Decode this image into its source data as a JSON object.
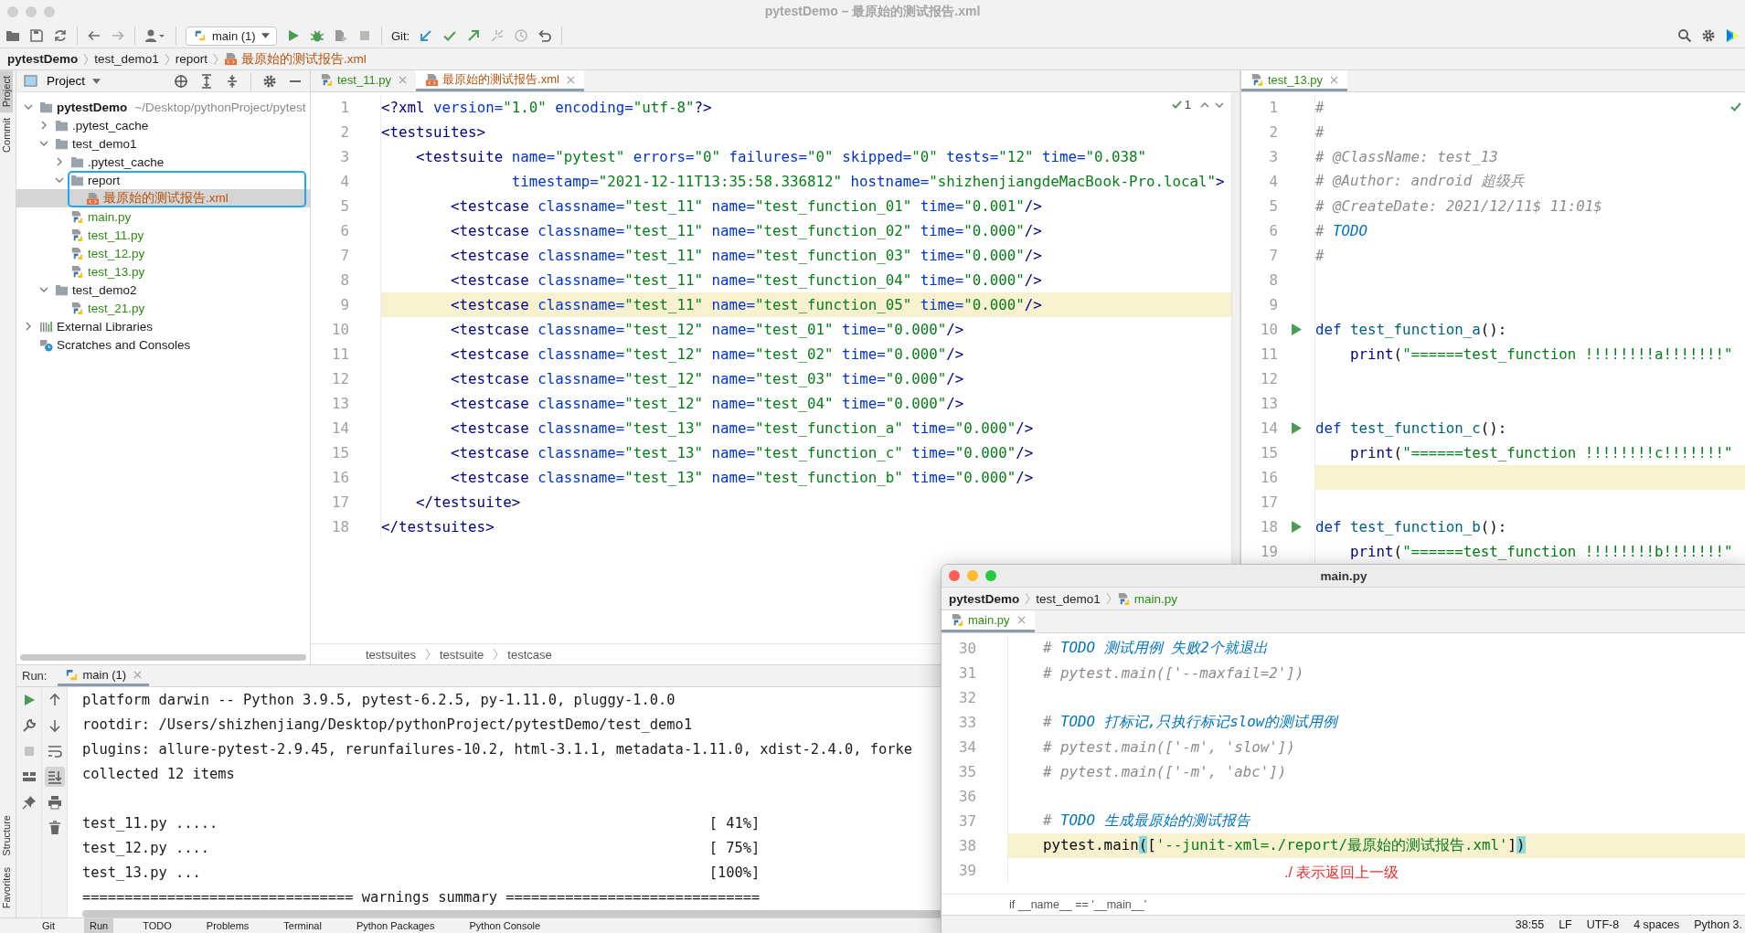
{
  "window": {
    "title": "pytestDemo – 最原始的测试报告.xml"
  },
  "toolbar": {
    "run_config": "main (1)",
    "git_label": "Git:"
  },
  "breadcrumb": [
    {
      "label": "pytestDemo",
      "kind": "project"
    },
    {
      "label": "test_demo1",
      "kind": "folder"
    },
    {
      "label": "report",
      "kind": "folder"
    },
    {
      "label": "最原始的测试报告.xml",
      "kind": "xml",
      "color": "#b5520b"
    }
  ],
  "side_tabs_top": [
    {
      "label": "Project",
      "selected": true
    },
    {
      "label": "Commit",
      "selected": false
    }
  ],
  "side_tabs_bottom": [
    {
      "label": "Structure",
      "selected": false
    },
    {
      "label": "Favorites",
      "selected": false
    }
  ],
  "project": {
    "title": "Project",
    "tree": [
      {
        "label": "pytestDemo",
        "path": "~/Desktop/pythonProject/pytest",
        "kind": "project",
        "expanded": true,
        "selected": false,
        "children": [
          {
            "label": ".pytest_cache",
            "kind": "folder",
            "expanded": false,
            "selected": false
          },
          {
            "label": "test_demo1",
            "kind": "folder",
            "expanded": true,
            "selected": false,
            "children": [
              {
                "label": ".pytest_cache",
                "kind": "folder",
                "expanded": false,
                "selected": false
              },
              {
                "label": "report",
                "kind": "folder",
                "expanded": true,
                "selected": false,
                "annotated": true,
                "children": [
                  {
                    "label": "最原始的测试报告.xml",
                    "kind": "xml",
                    "color": "#b5520b",
                    "selected": true
                  }
                ]
              },
              {
                "label": "main.py",
                "kind": "python",
                "color": "#2f8a14",
                "selected": false
              },
              {
                "label": "test_11.py",
                "kind": "python",
                "color": "#2f8a14",
                "selected": false
              },
              {
                "label": "test_12.py",
                "kind": "python",
                "color": "#2f8a14",
                "selected": false
              },
              {
                "label": "test_13.py",
                "kind": "python",
                "color": "#2f8a14",
                "selected": false
              }
            ]
          },
          {
            "label": "test_demo2",
            "kind": "folder",
            "expanded": true,
            "selected": false,
            "children": [
              {
                "label": "test_21.py",
                "kind": "python",
                "color": "#2f8a14",
                "selected": false
              }
            ]
          }
        ]
      },
      {
        "label": "External Libraries",
        "kind": "library",
        "expanded": false,
        "selected": false
      },
      {
        "label": "Scratches and Consoles",
        "kind": "scratches",
        "selected": false
      }
    ]
  },
  "editor_left": {
    "tabs": [
      {
        "label": "test_11.py",
        "kind": "python",
        "color": "#2f8a14",
        "selected": false
      },
      {
        "label": "最原始的测试报告.xml",
        "kind": "xml",
        "color": "#b5520b",
        "selected": true
      }
    ],
    "inspections": "1",
    "lines": [
      {
        "number": "1",
        "current": false,
        "tokens": [
          {
            "kind": "tag",
            "text": "<?xml"
          },
          {
            "kind": "attr",
            "text": " version="
          },
          {
            "kind": "value",
            "text": "\"1.0\""
          },
          {
            "kind": "attr",
            "text": " encoding="
          },
          {
            "kind": "value",
            "text": "\"utf-8\""
          },
          {
            "kind": "tag",
            "text": "?>"
          }
        ]
      },
      {
        "number": "2",
        "current": false,
        "tokens": [
          {
            "kind": "tag",
            "text": "<testsuites>"
          }
        ]
      },
      {
        "number": "3",
        "current": false,
        "tokens": [
          {
            "kind": "tag",
            "text": "    <testsuite"
          },
          {
            "kind": "attr",
            "text": " name="
          },
          {
            "kind": "value",
            "text": "\"pytest\""
          },
          {
            "kind": "attr",
            "text": " errors="
          },
          {
            "kind": "value",
            "text": "\"0\""
          },
          {
            "kind": "attr",
            "text": " failures="
          },
          {
            "kind": "value",
            "text": "\"0\""
          },
          {
            "kind": "attr",
            "text": " skipped="
          },
          {
            "kind": "value",
            "text": "\"0\""
          },
          {
            "kind": "attr",
            "text": " tests="
          },
          {
            "kind": "value",
            "text": "\"12\""
          },
          {
            "kind": "attr",
            "text": " time="
          },
          {
            "kind": "value",
            "text": "\"0.038\""
          }
        ]
      },
      {
        "number": "4",
        "current": false,
        "tokens": [
          {
            "kind": "attr",
            "text": "               timestamp="
          },
          {
            "kind": "value",
            "text": "\"2021-12-11T13:35:58.336812\""
          },
          {
            "kind": "attr",
            "text": " hostname="
          },
          {
            "kind": "value",
            "text": "\"shizhenjiangdeMacBook-Pro.local\""
          },
          {
            "kind": "tag",
            "text": ">"
          }
        ]
      },
      {
        "number": "5",
        "current": false,
        "tokens": [
          {
            "kind": "tag",
            "text": "        <testcase"
          },
          {
            "kind": "attr",
            "text": " classname="
          },
          {
            "kind": "value",
            "text": "\"test_11\""
          },
          {
            "kind": "attr",
            "text": " name="
          },
          {
            "kind": "value",
            "text": "\"test_function_01\""
          },
          {
            "kind": "attr",
            "text": " time="
          },
          {
            "kind": "value",
            "text": "\"0.001\""
          },
          {
            "kind": "tag",
            "text": "/>"
          }
        ]
      },
      {
        "number": "6",
        "current": false,
        "tokens": [
          {
            "kind": "tag",
            "text": "        <testcase"
          },
          {
            "kind": "attr",
            "text": " classname="
          },
          {
            "kind": "value",
            "text": "\"test_11\""
          },
          {
            "kind": "attr",
            "text": " name="
          },
          {
            "kind": "value",
            "text": "\"test_function_02\""
          },
          {
            "kind": "attr",
            "text": " time="
          },
          {
            "kind": "value",
            "text": "\"0.000\""
          },
          {
            "kind": "tag",
            "text": "/>"
          }
        ]
      },
      {
        "number": "7",
        "current": false,
        "tokens": [
          {
            "kind": "tag",
            "text": "        <testcase"
          },
          {
            "kind": "attr",
            "text": " classname="
          },
          {
            "kind": "value",
            "text": "\"test_11\""
          },
          {
            "kind": "attr",
            "text": " name="
          },
          {
            "kind": "value",
            "text": "\"test_function_03\""
          },
          {
            "kind": "attr",
            "text": " time="
          },
          {
            "kind": "value",
            "text": "\"0.000\""
          },
          {
            "kind": "tag",
            "text": "/>"
          }
        ]
      },
      {
        "number": "8",
        "current": false,
        "tokens": [
          {
            "kind": "tag",
            "text": "        <testcase"
          },
          {
            "kind": "attr",
            "text": " classname="
          },
          {
            "kind": "value",
            "text": "\"test_11\""
          },
          {
            "kind": "attr",
            "text": " name="
          },
          {
            "kind": "value",
            "text": "\"test_function_04\""
          },
          {
            "kind": "attr",
            "text": " time="
          },
          {
            "kind": "value",
            "text": "\"0.000\""
          },
          {
            "kind": "tag",
            "text": "/>"
          }
        ]
      },
      {
        "number": "9",
        "current": true,
        "tokens": [
          {
            "kind": "tag",
            "text": "        <testcase"
          },
          {
            "kind": "attr",
            "text": " classname="
          },
          {
            "kind": "value",
            "text": "\"test_11\""
          },
          {
            "kind": "attr",
            "text": " name="
          },
          {
            "kind": "value",
            "text": "\"test_function_05\""
          },
          {
            "kind": "attr",
            "text": " time="
          },
          {
            "kind": "value",
            "text": "\"0.000\""
          },
          {
            "kind": "tag",
            "text": "/>"
          }
        ]
      },
      {
        "number": "10",
        "current": false,
        "tokens": [
          {
            "kind": "tag",
            "text": "        <testcase"
          },
          {
            "kind": "attr",
            "text": " classname="
          },
          {
            "kind": "value",
            "text": "\"test_12\""
          },
          {
            "kind": "attr",
            "text": " name="
          },
          {
            "kind": "value",
            "text": "\"test_01\""
          },
          {
            "kind": "attr",
            "text": " time="
          },
          {
            "kind": "value",
            "text": "\"0.000\""
          },
          {
            "kind": "tag",
            "text": "/>"
          }
        ]
      },
      {
        "number": "11",
        "current": false,
        "tokens": [
          {
            "kind": "tag",
            "text": "        <testcase"
          },
          {
            "kind": "attr",
            "text": " classname="
          },
          {
            "kind": "value",
            "text": "\"test_12\""
          },
          {
            "kind": "attr",
            "text": " name="
          },
          {
            "kind": "value",
            "text": "\"test_02\""
          },
          {
            "kind": "attr",
            "text": " time="
          },
          {
            "kind": "value",
            "text": "\"0.000\""
          },
          {
            "kind": "tag",
            "text": "/>"
          }
        ]
      },
      {
        "number": "12",
        "current": false,
        "tokens": [
          {
            "kind": "tag",
            "text": "        <testcase"
          },
          {
            "kind": "attr",
            "text": " classname="
          },
          {
            "kind": "value",
            "text": "\"test_12\""
          },
          {
            "kind": "attr",
            "text": " name="
          },
          {
            "kind": "value",
            "text": "\"test_03\""
          },
          {
            "kind": "attr",
            "text": " time="
          },
          {
            "kind": "value",
            "text": "\"0.000\""
          },
          {
            "kind": "tag",
            "text": "/>"
          }
        ]
      },
      {
        "number": "13",
        "current": false,
        "tokens": [
          {
            "kind": "tag",
            "text": "        <testcase"
          },
          {
            "kind": "attr",
            "text": " classname="
          },
          {
            "kind": "value",
            "text": "\"test_12\""
          },
          {
            "kind": "attr",
            "text": " name="
          },
          {
            "kind": "value",
            "text": "\"test_04\""
          },
          {
            "kind": "attr",
            "text": " time="
          },
          {
            "kind": "value",
            "text": "\"0.000\""
          },
          {
            "kind": "tag",
            "text": "/>"
          }
        ]
      },
      {
        "number": "14",
        "current": false,
        "tokens": [
          {
            "kind": "tag",
            "text": "        <testcase"
          },
          {
            "kind": "attr",
            "text": " classname="
          },
          {
            "kind": "value",
            "text": "\"test_13\""
          },
          {
            "kind": "attr",
            "text": " name="
          },
          {
            "kind": "value",
            "text": "\"test_function_a\""
          },
          {
            "kind": "attr",
            "text": " time="
          },
          {
            "kind": "value",
            "text": "\"0.000\""
          },
          {
            "kind": "tag",
            "text": "/>"
          }
        ]
      },
      {
        "number": "15",
        "current": false,
        "tokens": [
          {
            "kind": "tag",
            "text": "        <testcase"
          },
          {
            "kind": "attr",
            "text": " classname="
          },
          {
            "kind": "value",
            "text": "\"test_13\""
          },
          {
            "kind": "attr",
            "text": " name="
          },
          {
            "kind": "value",
            "text": "\"test_function_c\""
          },
          {
            "kind": "attr",
            "text": " time="
          },
          {
            "kind": "value",
            "text": "\"0.000\""
          },
          {
            "kind": "tag",
            "text": "/>"
          }
        ]
      },
      {
        "number": "16",
        "current": false,
        "tokens": [
          {
            "kind": "tag",
            "text": "        <testcase"
          },
          {
            "kind": "attr",
            "text": " classname="
          },
          {
            "kind": "value",
            "text": "\"test_13\""
          },
          {
            "kind": "attr",
            "text": " name="
          },
          {
            "kind": "value",
            "text": "\"test_function_b\""
          },
          {
            "kind": "attr",
            "text": " time="
          },
          {
            "kind": "value",
            "text": "\"0.000\""
          },
          {
            "kind": "tag",
            "text": "/>"
          }
        ]
      },
      {
        "number": "17",
        "current": false,
        "tokens": [
          {
            "kind": "tag",
            "text": "    </testsuite>"
          }
        ]
      },
      {
        "number": "18",
        "current": false,
        "tokens": [
          {
            "kind": "tag",
            "text": "</testsuites>"
          }
        ]
      }
    ],
    "breadcrumb": [
      "testsuites",
      "testsuite",
      "testcase"
    ]
  },
  "editor_right": {
    "tabs": [
      {
        "label": "test_13.py",
        "kind": "python",
        "color": "#2f8a14",
        "selected": true
      }
    ],
    "lines": [
      {
        "number": "1",
        "current": false,
        "run": false,
        "tokens": [
          {
            "kind": "comment",
            "text": "#"
          }
        ]
      },
      {
        "number": "2",
        "current": false,
        "run": false,
        "tokens": [
          {
            "kind": "comment",
            "text": "#"
          }
        ]
      },
      {
        "number": "3",
        "current": false,
        "run": false,
        "tokens": [
          {
            "kind": "comment",
            "text": "# @ClassName: test_13"
          }
        ]
      },
      {
        "number": "4",
        "current": false,
        "run": false,
        "tokens": [
          {
            "kind": "comment",
            "text": "# @Author: android 超级兵"
          }
        ]
      },
      {
        "number": "5",
        "current": false,
        "run": false,
        "tokens": [
          {
            "kind": "comment",
            "text": "# @CreateDate: 2021/12/11$ 11:01$"
          }
        ]
      },
      {
        "number": "6",
        "current": false,
        "run": false,
        "tokens": [
          {
            "kind": "comment",
            "text": "# "
          },
          {
            "kind": "todo",
            "text": "TODO"
          }
        ]
      },
      {
        "number": "7",
        "current": false,
        "run": false,
        "tokens": [
          {
            "kind": "comment",
            "text": "#"
          }
        ]
      },
      {
        "number": "8",
        "current": false,
        "run": false
      },
      {
        "number": "9",
        "current": false,
        "run": false
      },
      {
        "number": "10",
        "current": false,
        "run": true,
        "tokens": [
          {
            "kind": "keyword",
            "text": "def"
          },
          {
            "kind": "func",
            "text": " test_function_a"
          },
          {
            "kind": "plain",
            "text": "():"
          }
        ]
      },
      {
        "number": "11",
        "current": false,
        "run": false,
        "tokens": [
          {
            "kind": "builtin",
            "text": "    print"
          },
          {
            "kind": "plain",
            "text": "("
          },
          {
            "kind": "string",
            "text": "\"======test_function !!!!!!!!a!!!!!!!\""
          }
        ]
      },
      {
        "number": "12",
        "current": false,
        "run": false
      },
      {
        "number": "13",
        "current": false,
        "run": false
      },
      {
        "number": "14",
        "current": false,
        "run": true,
        "tokens": [
          {
            "kind": "keyword",
            "text": "def"
          },
          {
            "kind": "func",
            "text": " test_function_c"
          },
          {
            "kind": "plain",
            "text": "():"
          }
        ]
      },
      {
        "number": "15",
        "current": false,
        "run": false,
        "tokens": [
          {
            "kind": "builtin",
            "text": "    print"
          },
          {
            "kind": "plain",
            "text": "("
          },
          {
            "kind": "string",
            "text": "\"======test_function !!!!!!!!c!!!!!!!\""
          }
        ]
      },
      {
        "number": "16",
        "current": true,
        "run": false
      },
      {
        "number": "17",
        "current": false,
        "run": false
      },
      {
        "number": "18",
        "current": false,
        "run": true,
        "tokens": [
          {
            "kind": "keyword",
            "text": "def"
          },
          {
            "kind": "func",
            "text": " test_function_b"
          },
          {
            "kind": "plain",
            "text": "():"
          }
        ]
      },
      {
        "number": "19",
        "current": false,
        "run": false,
        "tokens": [
          {
            "kind": "builtin",
            "text": "    print"
          },
          {
            "kind": "plain",
            "text": "("
          },
          {
            "kind": "string",
            "text": "\"======test_function !!!!!!!!b!!!!!!!\""
          }
        ]
      }
    ]
  },
  "run_panel": {
    "label": "Run:",
    "tab": "main (1)",
    "output": [
      {
        "kind": "text",
        "text": "platform darwin -- Python 3.9.5, pytest-6.2.5, py-1.11.0, pluggy-1.0.0"
      },
      {
        "kind": "text",
        "text": "rootdir: /Users/shizhenjiang/Desktop/pythonProject/pytestDemo/test_demo1"
      },
      {
        "kind": "text",
        "text": "plugins: allure-pytest-2.9.45, rerunfailures-10.2, html-3.1.1, metadata-1.11.0, xdist-2.4.0, forke"
      },
      {
        "kind": "text",
        "text": "collected 12 items"
      },
      {
        "kind": "blank"
      },
      {
        "kind": "progress",
        "text": "test_11.py .....",
        "progress": "[ 41%]"
      },
      {
        "kind": "progress",
        "text": "test_12.py ....",
        "progress": "[ 75%]"
      },
      {
        "kind": "progress",
        "text": "test_13.py ...",
        "progress": "[100%]"
      },
      {
        "kind": "text",
        "text": "================================ warnings summary =============================="
      }
    ]
  },
  "tool_tabs": [
    {
      "label": "Git",
      "selected": false
    },
    {
      "label": "Run",
      "selected": true
    },
    {
      "label": "TODO",
      "selected": false
    },
    {
      "label": "Problems",
      "selected": false
    },
    {
      "label": "Terminal",
      "selected": false
    },
    {
      "label": "Python Packages",
      "selected": false
    },
    {
      "label": "Python Console",
      "selected": false
    }
  ],
  "popup": {
    "title": "main.py",
    "breadcrumb": [
      {
        "label": "pytestDemo",
        "kind": "project"
      },
      {
        "label": "test_demo1",
        "kind": "folder"
      },
      {
        "label": "main.py",
        "kind": "python",
        "color": "#2f8a14"
      }
    ],
    "tabs": [
      {
        "label": "main.py",
        "kind": "python",
        "color": "#2f8a14",
        "selected": true
      }
    ],
    "lines": [
      {
        "number": "30",
        "current": false,
        "tokens": [
          {
            "kind": "comment",
            "text": "    # "
          },
          {
            "kind": "todo",
            "text": "TODO 测试用例 失败2个就退出"
          }
        ]
      },
      {
        "number": "31",
        "current": false,
        "tokens": [
          {
            "kind": "comment",
            "text": "    # pytest.main(['--maxfail=2'])"
          }
        ]
      },
      {
        "number": "32",
        "current": false
      },
      {
        "number": "33",
        "current": false,
        "tokens": [
          {
            "kind": "comment",
            "text": "    # "
          },
          {
            "kind": "todo",
            "text": "TODO 打标记,只执行标记slow的测试用例"
          }
        ]
      },
      {
        "number": "34",
        "current": false,
        "tokens": [
          {
            "kind": "comment",
            "text": "    # pytest.main(['-m', 'slow'])"
          }
        ]
      },
      {
        "number": "35",
        "current": false,
        "tokens": [
          {
            "kind": "comment",
            "text": "    # pytest.main(['-m', 'abc'])"
          }
        ]
      },
      {
        "number": "36",
        "current": false
      },
      {
        "number": "37",
        "current": false,
        "tokens": [
          {
            "kind": "comment",
            "text": "    # "
          },
          {
            "kind": "todo",
            "text": "TODO 生成最原始的测试报告"
          }
        ]
      },
      {
        "number": "38",
        "current": true,
        "tokens": [
          {
            "kind": "plain",
            "text": "    pytest.main"
          },
          {
            "kind": "brace",
            "text": "("
          },
          {
            "kind": "plain",
            "text": "["
          },
          {
            "kind": "string",
            "text": "'--junit-xml=./report/最原始的测试报告.xml'"
          },
          {
            "kind": "plain",
            "text": "]"
          },
          {
            "kind": "brace",
            "text": ")"
          }
        ]
      },
      {
        "number": "39",
        "current": false
      }
    ],
    "annotation": "./ 表示返回上一级",
    "code_breadcrumb": "if __name__ == '__main__'",
    "status": [
      "38:55",
      "LF",
      "UTF-8",
      "4 spaces",
      "Python 3."
    ]
  }
}
